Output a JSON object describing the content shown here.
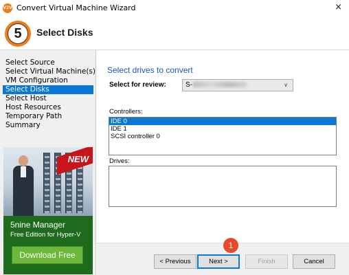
{
  "window": {
    "title": "Convert Virtual Machine Wizard",
    "icon_text": "V2V",
    "close": "×"
  },
  "header": {
    "step_number": "5",
    "step_title": "Select Disks"
  },
  "sidebar": {
    "items": [
      {
        "label": "Select Source",
        "active": false
      },
      {
        "label": "Select Virtual Machine(s)",
        "active": false
      },
      {
        "label": "VM Configuration",
        "active": false
      },
      {
        "label": "Select Disks",
        "active": true
      },
      {
        "label": "Select Host",
        "active": false
      },
      {
        "label": "Host Resources",
        "active": false
      },
      {
        "label": "Temporary Path",
        "active": false
      },
      {
        "label": "Summary",
        "active": false
      }
    ]
  },
  "promo": {
    "badge": "NEW",
    "product": "5nine Manager",
    "subtitle": "Free Edition for Hyper-V",
    "button": "Download Free"
  },
  "main": {
    "section_title": "Select drives to convert",
    "review_label": "Select for review:",
    "review_value_prefix": "S-",
    "controllers_label": "Controllers:",
    "controllers": [
      "IDE 0",
      "IDE 1",
      "SCSI controller 0"
    ],
    "selected_controller": 0,
    "drives_label": "Drives:",
    "drives": []
  },
  "footer": {
    "previous": "< Previous",
    "next": "Next >",
    "finish": "Finish",
    "cancel": "Cancel",
    "callout": "1"
  },
  "colors": {
    "accent": "#0a78d7",
    "brand_orange": "#f07c14",
    "section_title": "#1a57b4",
    "callout": "#e8492b",
    "promo_green": "#1f6b1d"
  }
}
